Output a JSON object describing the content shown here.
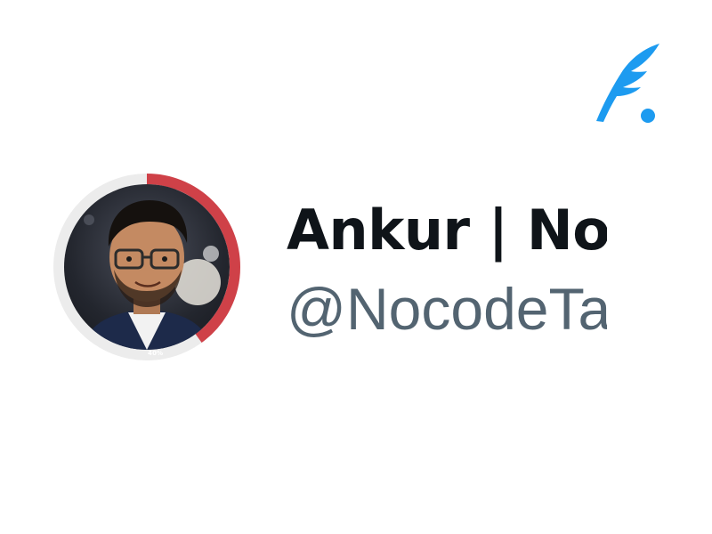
{
  "profile": {
    "display_name": "Ankur | NoC",
    "handle": "@NocodeTa",
    "progress_label": "40%",
    "progress_fraction": 0.4,
    "avatar_description": "profile photo"
  },
  "brand": {
    "logo_icon": "quill-dot-logo-icon",
    "accent_color": "#1d9bf0"
  },
  "colors": {
    "progress_color": "#cf4148",
    "track_color": "#ececec",
    "name_color": "#0f1419",
    "handle_color": "#536471"
  }
}
